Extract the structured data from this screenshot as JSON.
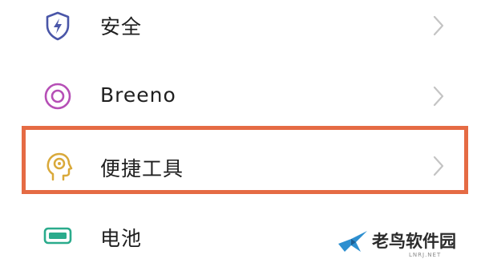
{
  "settings": {
    "items": [
      {
        "label": "安全",
        "icon": "shield-icon",
        "icon_color": "#4a56a8"
      },
      {
        "label": "Breeno",
        "icon": "breeno-icon",
        "icon_color": "#b64fb6"
      },
      {
        "label": "便捷工具",
        "icon": "head-gear-icon",
        "icon_color": "#d9a93a"
      },
      {
        "label": "电池",
        "icon": "battery-icon",
        "icon_color": "#2aab8c"
      }
    ]
  },
  "highlight": {
    "color": "#e56b44",
    "target": "便捷工具"
  },
  "watermark": {
    "name": "老鸟软件园",
    "domain": "LNRJ.NET"
  }
}
